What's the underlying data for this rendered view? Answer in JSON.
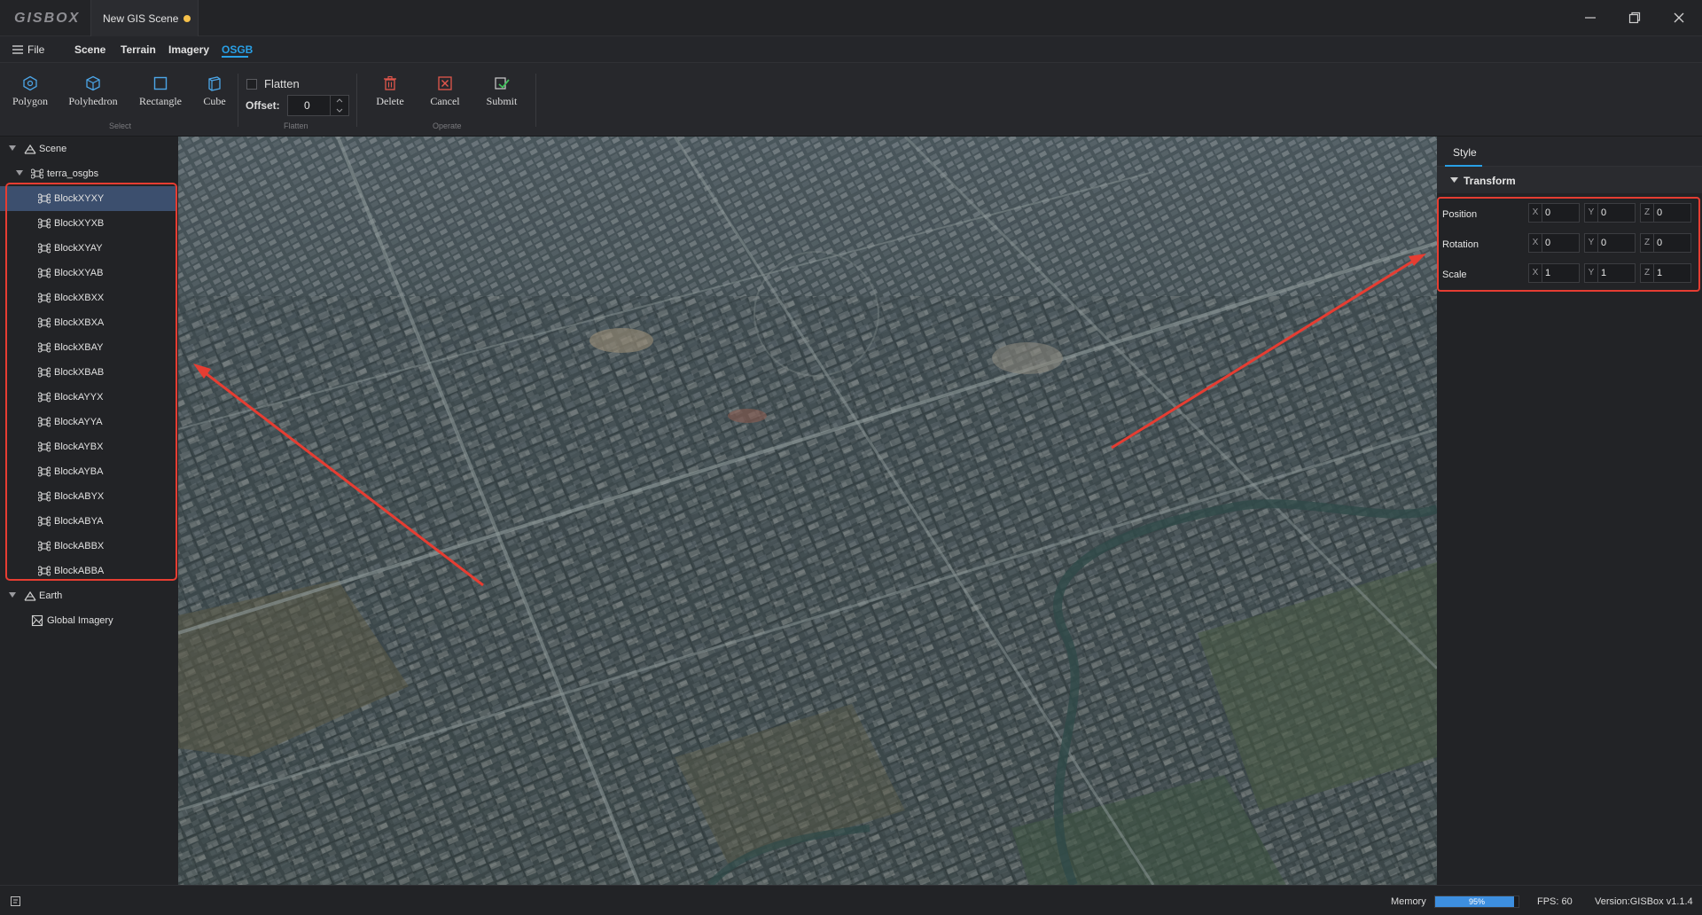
{
  "app": {
    "logo_text": "GISBOX",
    "document_tab": "New GIS Scene"
  },
  "menu": {
    "file": "File",
    "items": [
      "Scene",
      "Terrain",
      "Imagery",
      "OSGB"
    ],
    "active": "OSGB"
  },
  "ribbon": {
    "select_group": {
      "label": "Select",
      "buttons": [
        "Polygon",
        "Polyhedron",
        "Rectangle",
        "Cube"
      ]
    },
    "flatten_group": {
      "label": "Flatten",
      "checkbox_label": "Flatten",
      "offset_label": "Offset:",
      "offset_value": "0"
    },
    "operate_group": {
      "label": "Operate",
      "buttons": [
        "Delete",
        "Cancel",
        "Submit"
      ]
    }
  },
  "tree": {
    "scene_label": "Scene",
    "layer_label": "terra_osgbs",
    "blocks": [
      "BlockXYXY",
      "BlockXYXB",
      "BlockXYAY",
      "BlockXYAB",
      "BlockXBXX",
      "BlockXBXA",
      "BlockXBAY",
      "BlockXBAB",
      "BlockAYYX",
      "BlockAYYA",
      "BlockAYBX",
      "BlockAYBA",
      "BlockABYX",
      "BlockABYA",
      "BlockABBX",
      "BlockABBA"
    ],
    "selected": "BlockXYXY",
    "earth_label": "Earth",
    "imagery_label": "Global Imagery"
  },
  "properties": {
    "tab": "Style",
    "section": "Transform",
    "rows": [
      {
        "label": "Position",
        "x": "0",
        "y": "0",
        "z": "0"
      },
      {
        "label": "Rotation",
        "x": "0",
        "y": "0",
        "z": "0"
      },
      {
        "label": "Scale",
        "x": "1",
        "y": "1",
        "z": "1"
      }
    ],
    "axes": [
      "X",
      "Y",
      "Z"
    ]
  },
  "status": {
    "memory_label": "Memory",
    "memory_value": "95%",
    "memory_fraction": 0.95,
    "fps": "FPS: 60",
    "version": "Version:GISBox v1.1.4"
  },
  "colors": {
    "accent": "#29a0e6",
    "highlight": "#e63d32",
    "selected_row": "#3c4f6e",
    "unsaved_dot": "#f5c04a"
  }
}
